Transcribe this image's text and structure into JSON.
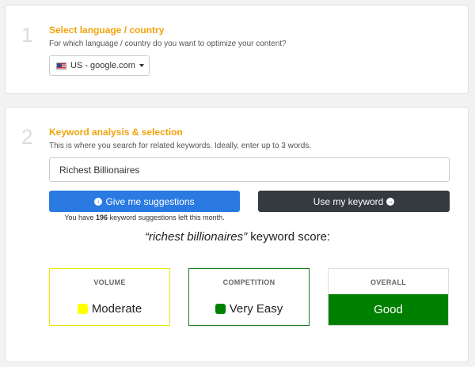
{
  "step1": {
    "number": "1",
    "title": "Select language / country",
    "subtitle": "For which language / country do you want to optimize your content?",
    "language_select": {
      "value": "US - google.com",
      "icon": "us-flag-icon"
    }
  },
  "step2": {
    "number": "2",
    "title": "Keyword analysis & selection",
    "subtitle": "This is where you search for related keywords. Ideally, enter up to 3 words.",
    "keyword_input": {
      "value": "Richest Billionaires"
    },
    "suggest_button": {
      "label": "Give me suggestions",
      "icon": "arrow-circle-down-icon"
    },
    "use_button": {
      "label": "Use my keyword",
      "icon": "arrow-circle-right-icon"
    },
    "suggestions_left": {
      "prefix": "You have ",
      "count": "196",
      "suffix": " keyword suggestions left this month."
    },
    "score_heading": {
      "keyword": "“richest billionaires”",
      "suffix": " keyword score:"
    },
    "scores": {
      "volume": {
        "label": "VOLUME",
        "value": "Moderate",
        "color": "#ffff00"
      },
      "competition": {
        "label": "COMPETITION",
        "value": "Very Easy",
        "color": "#008000"
      },
      "overall": {
        "label": "OVERALL",
        "value": "Good",
        "color": "#008000"
      }
    }
  }
}
